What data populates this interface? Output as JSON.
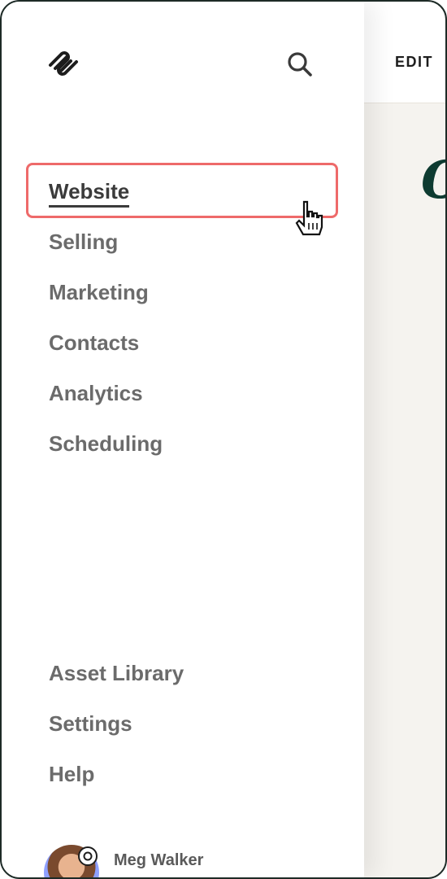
{
  "preview": {
    "edit_label": "EDIT"
  },
  "sidebar": {
    "logo_icon": "squarespace-logo-icon",
    "search_icon": "search-icon",
    "primary_nav": [
      {
        "label": "Website",
        "active": true
      },
      {
        "label": "Selling"
      },
      {
        "label": "Marketing"
      },
      {
        "label": "Contacts"
      },
      {
        "label": "Analytics"
      },
      {
        "label": "Scheduling"
      }
    ],
    "secondary_nav": [
      {
        "label": "Asset Library"
      },
      {
        "label": "Settings"
      },
      {
        "label": "Help"
      }
    ],
    "user": {
      "name": "Meg Walker"
    }
  },
  "colors": {
    "highlight": "#ee6a6a",
    "preview_accent": "#0e3b31"
  }
}
